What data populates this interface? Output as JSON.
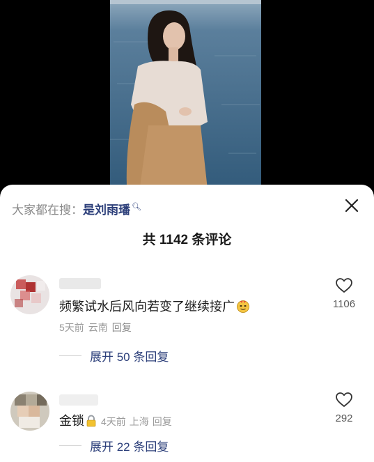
{
  "search": {
    "prefix": "大家都在搜：",
    "term": "是刘雨璠",
    "icon": "search-icon"
  },
  "comments_header": {
    "title": "共 1142 条评论"
  },
  "comments": [
    {
      "text": "频繁试水后风向若变了继续接广",
      "emoji": "sly-face-emoji",
      "time": "5天前",
      "location": "云南",
      "reply_label": "回复",
      "likes": "1106",
      "expand_label": "展开 50 条回复"
    },
    {
      "text": "金锁",
      "emoji": "lock-emoji",
      "time": "4天前",
      "location": "上海",
      "reply_label": "回复",
      "likes": "292",
      "expand_label": "展开 22 条回复"
    }
  ],
  "colors": {
    "link": "#2c3f7a",
    "meta": "#9a9a9a",
    "sheet": "#ffffff"
  }
}
